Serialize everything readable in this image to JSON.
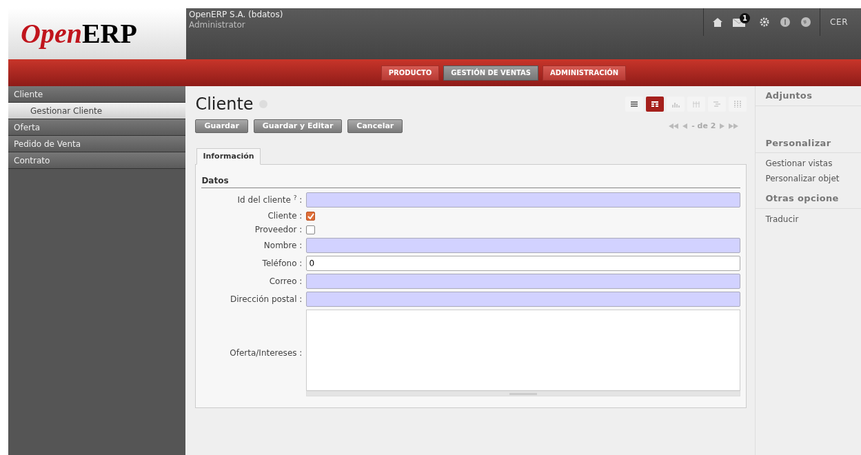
{
  "header": {
    "logo_left": "Open",
    "logo_right": "ERP",
    "company": "OpenERP S.A. (bdatos)",
    "user": "Administrator",
    "notification_count": "1",
    "logout": "CER"
  },
  "menu": [
    {
      "label": "PRODUCTO",
      "selected": false
    },
    {
      "label": "GESTIÓN DE VENTAS",
      "selected": true
    },
    {
      "label": "ADMINISTRACIÓN",
      "selected": false
    }
  ],
  "sidebar": {
    "items": [
      {
        "label": "Cliente",
        "selected": false,
        "children": [
          {
            "label": "Gestionar Cliente",
            "selected": true
          }
        ]
      },
      {
        "label": "Oferta",
        "selected": false
      },
      {
        "label": "Pedido de Venta",
        "selected": false
      },
      {
        "label": "Contrato",
        "selected": false
      }
    ]
  },
  "form": {
    "title": "Cliente",
    "buttons": [
      "Guardar",
      "Guardar y Editar",
      "Cancelar"
    ],
    "views": [
      {
        "kind": "list",
        "selected": false
      },
      {
        "kind": "form",
        "selected": true
      },
      {
        "kind": "graph",
        "selected": false
      },
      {
        "kind": "calendar",
        "selected": false
      },
      {
        "kind": "gantt",
        "selected": false
      },
      {
        "kind": "grid",
        "selected": false
      }
    ],
    "pager": "- de 2",
    "tabs": [
      {
        "label": "Información",
        "selected": true
      }
    ],
    "section": "Datos",
    "fields": [
      {
        "kind": "text",
        "label": "Id del cliente $^{?}$ :",
        "required": true
      },
      {
        "kind": "checkbox",
        "label": "Cliente :",
        "checked": true
      },
      {
        "kind": "checkbox",
        "label": "Proveedor :",
        "checked": false
      },
      {
        "kind": "text",
        "label": "Nombre :",
        "required": true
      },
      {
        "kind": "text",
        "label": "Teléfono :",
        "required": false,
        "value": "0"
      },
      {
        "kind": "text",
        "label": "Correo :",
        "required": true
      },
      {
        "kind": "text",
        "label": "Dirección postal :",
        "required": true
      },
      {
        "kind": "textarea",
        "label": "Oferta/Intereses :",
        "required": false
      }
    ]
  },
  "right_panel": [
    {
      "title": "Adjuntos"
    },
    {
      "title": "Personalizar",
      "items": [
        "Gestionar vistas",
        "Personalizar objet"
      ]
    },
    {
      "title": "Otras opcione",
      "items": [
        "Traducir"
      ]
    }
  ]
}
